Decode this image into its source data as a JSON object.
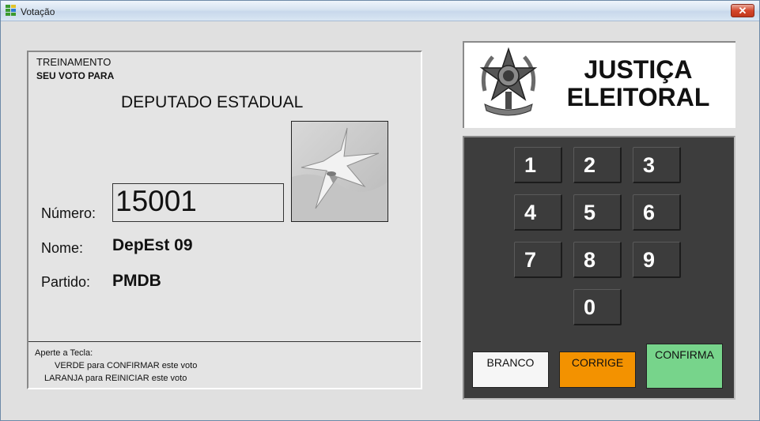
{
  "window": {
    "title": "Votação",
    "close_glyph": "✕"
  },
  "ballot": {
    "mode": "TREINAMENTO",
    "prompt": "SEU VOTO PARA",
    "office": "DEPUTADO ESTADUAL",
    "number_label": "Número:",
    "number": "15001",
    "name_label": "Nome:",
    "name": "DepEst 09",
    "party_label": "Partido:",
    "party": "PMDB",
    "instructions": {
      "heading": "Aperte a Tecla:",
      "green": "VERDE para CONFIRMAR este voto",
      "orange": "LARANJA para REINICIAR este voto"
    }
  },
  "logo": {
    "line1": "JUSTIÇA",
    "line2": "ELEITORAL"
  },
  "keypad": {
    "keys": [
      "1",
      "2",
      "3",
      "4",
      "5",
      "6",
      "7",
      "8",
      "9",
      "0"
    ],
    "branco": "BRANCO",
    "corrige": "CORRIGE",
    "confirma": "CONFIRMA",
    "colors": {
      "branco": "#f6f6f6",
      "corrige": "#f39200",
      "confirma": "#77d48b"
    }
  }
}
